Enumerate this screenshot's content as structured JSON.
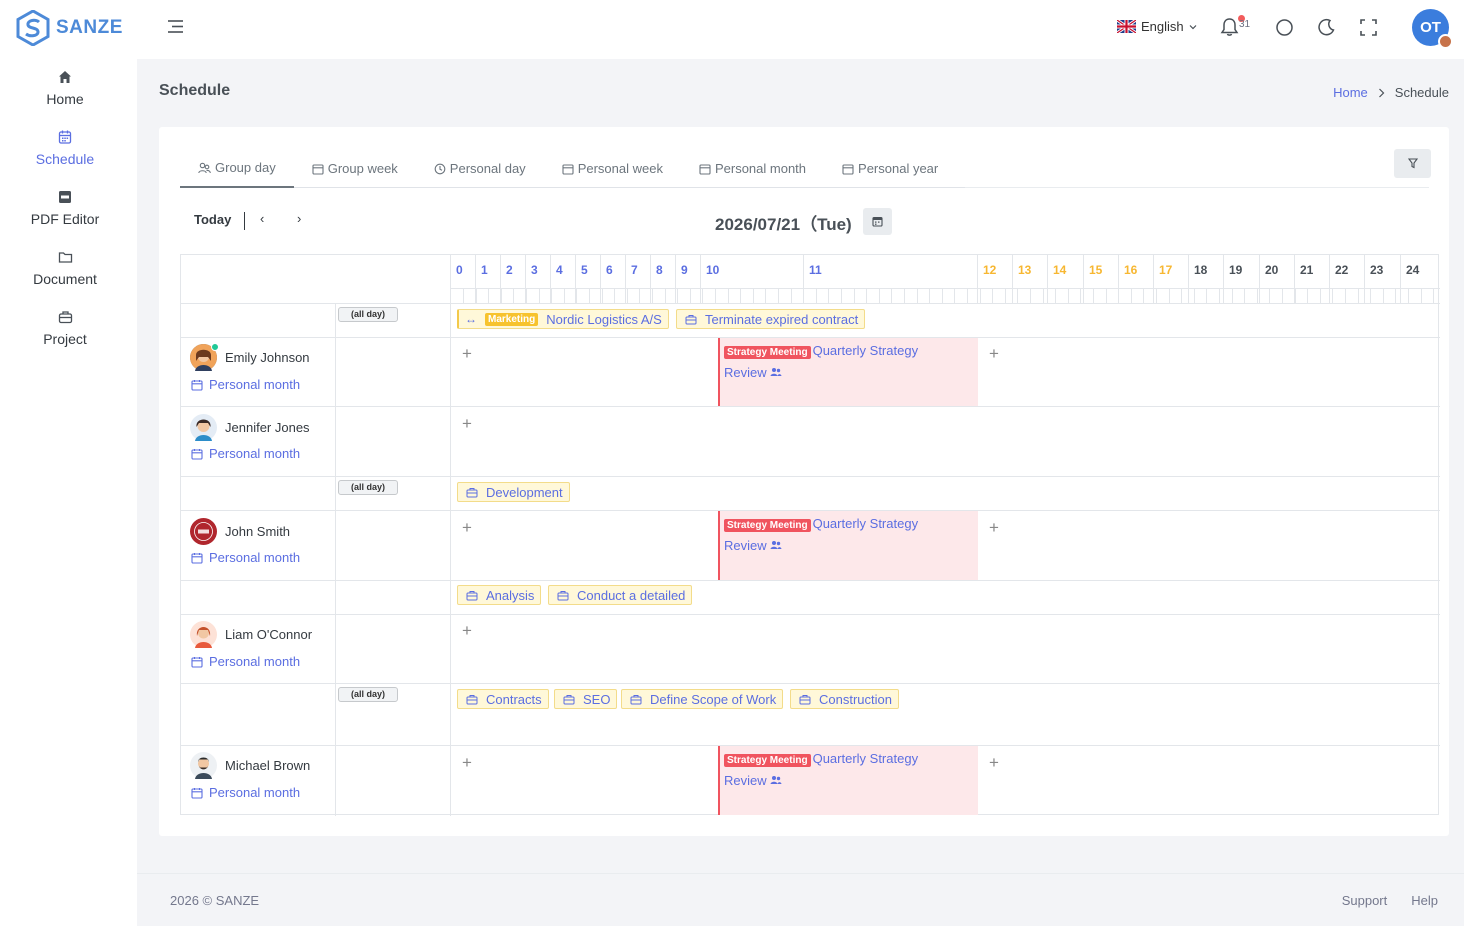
{
  "brand": {
    "name": "SANZE"
  },
  "sidebar": {
    "items": [
      {
        "label": "Home",
        "icon": "home-icon"
      },
      {
        "label": "Schedule",
        "icon": "calendar-icon"
      },
      {
        "label": "PDF Editor",
        "icon": "pdf-icon"
      },
      {
        "label": "Document",
        "icon": "folder-icon"
      },
      {
        "label": "Project",
        "icon": "briefcase-icon"
      }
    ]
  },
  "topbar": {
    "language": "English",
    "notification_count": "31",
    "user_initials": "OT"
  },
  "page": {
    "title": "Schedule"
  },
  "breadcrumb": {
    "home": "Home",
    "current": "Schedule"
  },
  "tabs": [
    {
      "label": "Group day",
      "icon": "people-icon"
    },
    {
      "label": "Group week",
      "icon": "calendar-icon"
    },
    {
      "label": "Personal day",
      "icon": "clock-icon"
    },
    {
      "label": "Personal week",
      "icon": "calendar-icon"
    },
    {
      "label": "Personal month",
      "icon": "calendar-icon"
    },
    {
      "label": "Personal year",
      "icon": "calendar-icon"
    }
  ],
  "toolbar": {
    "today": "Today",
    "prev": "‹",
    "next": "›",
    "date": "2026/07/21（Tue)"
  },
  "hours": [
    "0",
    "1",
    "2",
    "3",
    "4",
    "5",
    "6",
    "7",
    "8",
    "9",
    "10",
    "11",
    "12",
    "13",
    "14",
    "15",
    "16",
    "17",
    "18",
    "19",
    "20",
    "21",
    "22",
    "23",
    "24"
  ],
  "allday_label": "(all day)",
  "rows": {
    "r1": {
      "tasks": [
        {
          "tag": "Marketing",
          "text": "Nordic Logistics A/S"
        },
        {
          "text": "Terminate expired contract"
        }
      ]
    },
    "emily": {
      "name": "Emily Johnson",
      "link": "Personal month"
    },
    "jennifer": {
      "name": "Jennifer Jones",
      "link": "Personal month"
    },
    "r4": {
      "tasks": [
        {
          "text": "Development"
        }
      ]
    },
    "john": {
      "name": "John Smith",
      "link": "Personal month"
    },
    "r6": {
      "tasks": [
        {
          "text": "Analysis"
        },
        {
          "text": "Conduct a detailed"
        }
      ]
    },
    "liam": {
      "name": "Liam O'Connor",
      "link": "Personal month"
    },
    "r8": {
      "tasks": [
        {
          "text": "Contracts"
        },
        {
          "text": "SEO"
        },
        {
          "text": "Define Scope of Work"
        },
        {
          "text": "Construction"
        }
      ]
    },
    "michael": {
      "name": "Michael Brown",
      "link": "Personal month"
    }
  },
  "meeting": {
    "tag": "Strategy Meeting",
    "title1": "Quarterly Strategy",
    "title2": "Review"
  },
  "footer": {
    "copyright": "2026 © SANZE",
    "support": "Support",
    "help": "Help"
  },
  "colors": {
    "accent": "#5b6ee1",
    "hour_weekday": "#5b6ee1",
    "hour_off": "#f7b731",
    "hour_late": "#495057",
    "meeting_bg": "#fde8ea",
    "meeting_tag": "#f0545f",
    "task_bg": "#fff8d9",
    "task_tag": "#f7c32e"
  }
}
